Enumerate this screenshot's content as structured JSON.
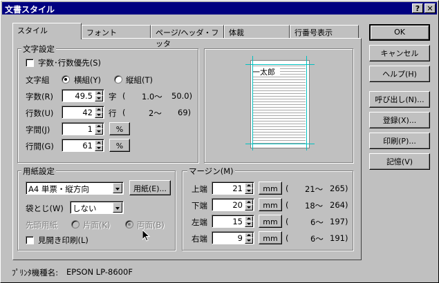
{
  "window": {
    "title": "文書スタイル",
    "help_btn": "?",
    "close_btn": "✕"
  },
  "tabs": [
    "スタイル",
    "フォント",
    "ページ/ヘッダ・フッタ",
    "体裁",
    "行番号表示"
  ],
  "char_settings": {
    "group_label": "文字設定",
    "priority_label": "字数･行数優先(S)",
    "priority_checked": false,
    "orientation_label": "文字組",
    "horizontal_label": "横組(Y)",
    "vertical_label": "縦組(T)",
    "selected": "horizontal",
    "chars_label": "字数(R)",
    "chars_value": "49.5",
    "chars_unit": "字",
    "chars_range_open": "(",
    "chars_min": "1.0～",
    "chars_max": "50.0)",
    "lines_label": "行数(U)",
    "lines_value": "42",
    "lines_unit": "行",
    "lines_range_open": "(",
    "lines_min": "2～",
    "lines_max": "69)",
    "char_spacing_label": "字間(J)",
    "char_spacing_value": "1",
    "line_spacing_label": "行間(G)",
    "line_spacing_value": "61",
    "percent": "%"
  },
  "preview": {
    "sample_text": "一太郎"
  },
  "paper_settings": {
    "group_label": "用紙設定",
    "paper_value": "A4 単票・縦方向",
    "paper_button": "用紙(E)...",
    "binding_label": "袋とじ(W)",
    "binding_value": "しない",
    "first_page_label": "先頭用紙",
    "one_side_label": "片面(K)",
    "both_side_label": "両面(B)",
    "spread_print_label": "見開き印刷(L)",
    "spread_print_checked": false
  },
  "margins": {
    "group_label": "マージン(M)",
    "unit": "mm",
    "items": [
      {
        "label": "上端",
        "value": "21",
        "open": "(",
        "min": "21～",
        "max": "265)"
      },
      {
        "label": "下端",
        "value": "20",
        "open": "(",
        "min": "18～",
        "max": "264)"
      },
      {
        "label": "左端",
        "value": "15",
        "open": "(",
        "min": "6～",
        "max": "197)"
      },
      {
        "label": "右端",
        "value": "9",
        "open": "(",
        "min": "6～",
        "max": "191)"
      }
    ]
  },
  "printer": {
    "label": "ﾌﾟﾘﾝﾀ機種名:",
    "name": "EPSON LP-8600F"
  },
  "buttons": [
    "OK",
    "キャンセル",
    "ヘルプ(H)",
    "呼び出し(N)...",
    "登録(X)...",
    "印刷(P)...",
    "記憶(V)"
  ]
}
